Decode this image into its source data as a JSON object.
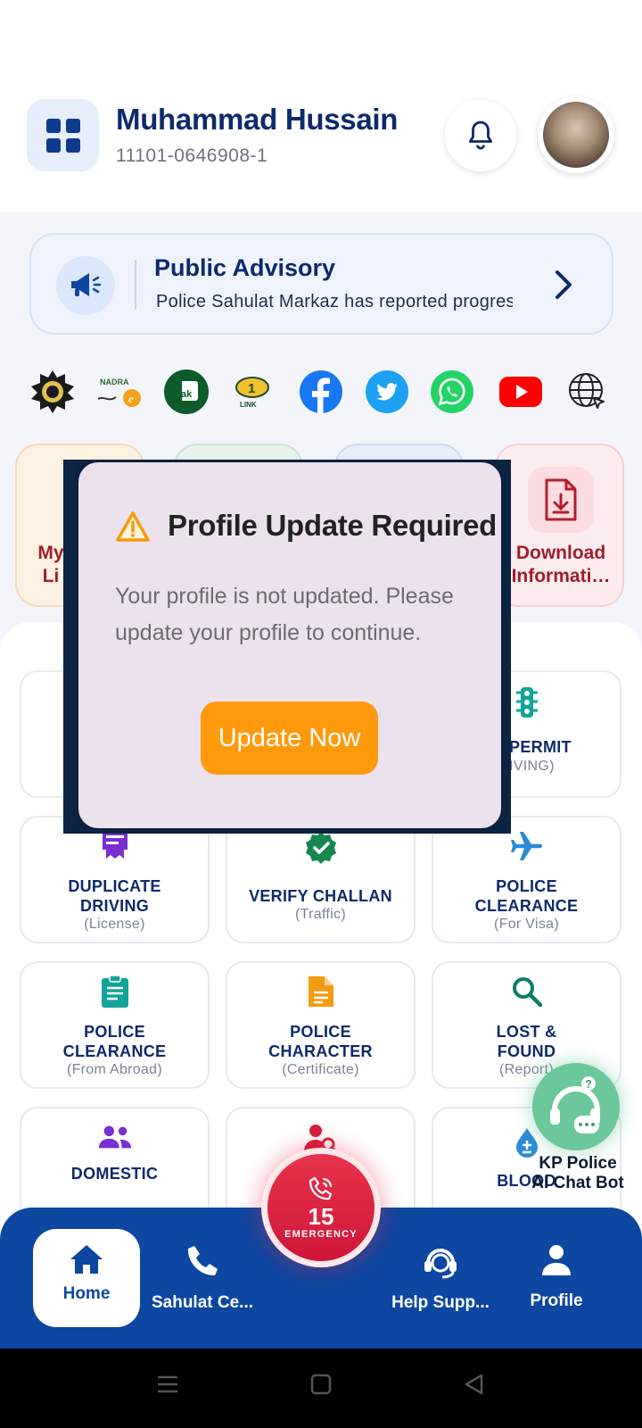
{
  "header": {
    "user_name": "Muhammad Hussain",
    "cnic": "11101-0646908-1",
    "menu_icon": "grid-menu-icon",
    "bell_icon": "bell-icon"
  },
  "advisory": {
    "title": "Public Advisory",
    "text": "Police Sahulat Markaz has reported progress",
    "icon": "megaphone-icon"
  },
  "logos": [
    {
      "name": "kp-police-logo"
    },
    {
      "name": "nadra-logo",
      "text": "NADRA"
    },
    {
      "name": "pak-id-logo",
      "text": "Pak"
    },
    {
      "name": "1link-logo",
      "text": "1"
    },
    {
      "name": "facebook-logo"
    },
    {
      "name": "twitter-logo"
    },
    {
      "name": "whatsapp-logo"
    },
    {
      "name": "youtube-logo"
    },
    {
      "name": "web-logo"
    }
  ],
  "quick_cards": {
    "left_label_line1": "My",
    "left_label_line2": "Li",
    "right_label_line1": "Download",
    "right_label_line2": "Informati…"
  },
  "services": [
    {
      "title_line1": "ER PERMIT",
      "title_line2": "",
      "sub": "RIVING)"
    },
    {
      "title_line1": "DUPLICATE",
      "title_line2": "DRIVING",
      "sub": "(License)"
    },
    {
      "title_line1": "VERIFY CHALLAN",
      "title_line2": "",
      "sub": "(Traffic)"
    },
    {
      "title_line1": "POLICE",
      "title_line2": "CLEARANCE",
      "sub": "(For Visa)"
    },
    {
      "title_line1": "POLICE",
      "title_line2": "CLEARANCE",
      "sub": "(From Abroad)"
    },
    {
      "title_line1": "POLICE",
      "title_line2": "CHARACTER",
      "sub": "(Certificate)"
    },
    {
      "title_line1": "LOST &",
      "title_line2": "FOUND",
      "sub": "(Report)"
    },
    {
      "title_line1": "DOMESTIC",
      "title_line2": "",
      "sub": ""
    },
    {
      "title_line1": "BLOOD",
      "title_line2": "",
      "sub": ""
    }
  ],
  "chatbot": {
    "line1": "KP Police",
    "line2": "AI Chat Bot"
  },
  "emergency": {
    "number": "15",
    "label": "EMERGENCY"
  },
  "nav": {
    "home": "Home",
    "sahulat": "Sahulat Ce...",
    "help": "Help Supp...",
    "profile": "Profile"
  },
  "modal": {
    "title": "Profile Update Required",
    "message": "Your profile is not updated. Please update your profile to continue.",
    "button": "Update Now"
  },
  "colors": {
    "primary": "#0e47a1",
    "emergency": "#d81e3f",
    "modal_button": "#ff9a0d",
    "chatbot": "#6cc79a"
  }
}
